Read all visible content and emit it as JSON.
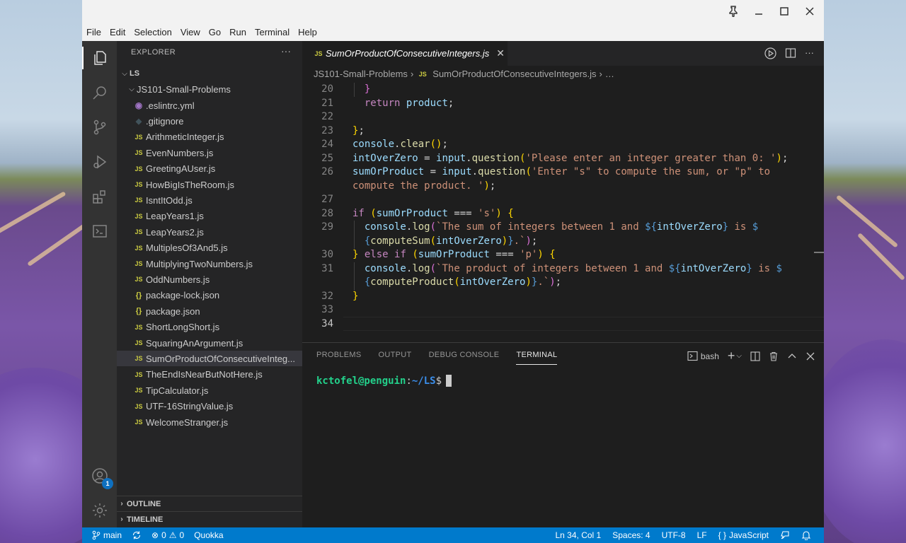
{
  "menu": [
    "File",
    "Edit",
    "Selection",
    "View",
    "Go",
    "Run",
    "Terminal",
    "Help"
  ],
  "explorer": {
    "title": "EXPLORER",
    "more": "···",
    "root": "LS",
    "folder": "JS101-Small-Problems",
    "files": [
      {
        "name": ".eslintrc.yml",
        "icon": "yml"
      },
      {
        "name": ".gitignore",
        "icon": "git"
      },
      {
        "name": "ArithmeticInteger.js",
        "icon": "js"
      },
      {
        "name": "EvenNumbers.js",
        "icon": "js"
      },
      {
        "name": "GreetingAUser.js",
        "icon": "js"
      },
      {
        "name": "HowBigIsTheRoom.js",
        "icon": "js"
      },
      {
        "name": "IsntItOdd.js",
        "icon": "js"
      },
      {
        "name": "LeapYears1.js",
        "icon": "js"
      },
      {
        "name": "LeapYears2.js",
        "icon": "js"
      },
      {
        "name": "MultiplesOf3And5.js",
        "icon": "js"
      },
      {
        "name": "MultiplyingTwoNumbers.js",
        "icon": "js"
      },
      {
        "name": "OddNumbers.js",
        "icon": "js"
      },
      {
        "name": "package-lock.json",
        "icon": "json"
      },
      {
        "name": "package.json",
        "icon": "json"
      },
      {
        "name": "ShortLongShort.js",
        "icon": "js"
      },
      {
        "name": "SquaringAnArgument.js",
        "icon": "js"
      },
      {
        "name": "SumOrProductOfConsecutiveInteg...",
        "icon": "js",
        "selected": true
      },
      {
        "name": "TheEndIsNearButNotHere.js",
        "icon": "js"
      },
      {
        "name": "TipCalculator.js",
        "icon": "js"
      },
      {
        "name": "UTF-16StringValue.js",
        "icon": "js"
      },
      {
        "name": "WelcomeStranger.js",
        "icon": "js"
      }
    ],
    "outline": "OUTLINE",
    "timeline": "TIMELINE"
  },
  "file_icon_labels": {
    "js": "JS",
    "json": "{}",
    "yml": "◉",
    "git": "◆"
  },
  "editor": {
    "tab_label": "SumOrProductOfConsecutiveIntegers.js",
    "tab_close": "✕",
    "breadcrumb": [
      "JS101-Small-Problems",
      "SumOrProductOfConsecutiveIntegers.js",
      "…"
    ],
    "lines": [
      {
        "n": "20",
        "html": "  <span class=\"br2\">}</span>"
      },
      {
        "n": "21",
        "html": "  <span class=\"kw\">return</span> <span class=\"id\">product</span>;"
      },
      {
        "n": "22",
        "html": ""
      },
      {
        "n": "23",
        "html": "<span class=\"br\">}</span>;"
      },
      {
        "n": "24",
        "html": "<span class=\"id\">console</span>.<span class=\"fn\">clear</span><span class=\"br\">()</span>;"
      },
      {
        "n": "25",
        "html": "<span class=\"id\">intOverZero</span> = <span class=\"id\">input</span>.<span class=\"fn\">question</span><span class=\"br\">(</span><span class=\"str\">'Please enter an integer greater than 0: '</span><span class=\"br\">)</span>;"
      },
      {
        "n": "26",
        "html": "<span class=\"id\">sumOrProduct</span> = <span class=\"id\">input</span>.<span class=\"fn\">question</span><span class=\"br\">(</span><span class=\"str\">'Enter \"s\" to compute the sum, or \"p\" to</span>"
      },
      {
        "n": "",
        "html": "<span class=\"str\">compute the product. '</span><span class=\"br\">)</span>;"
      },
      {
        "n": "27",
        "html": ""
      },
      {
        "n": "28",
        "html": "<span class=\"kw\">if</span> <span class=\"br\">(</span><span class=\"id\">sumOrProduct</span> === <span class=\"str\">'s'</span><span class=\"br\">)</span> <span class=\"br\">{</span>"
      },
      {
        "n": "29",
        "html": "  <span class=\"id\">console</span>.<span class=\"fn\">log</span><span class=\"br2\">(</span><span class=\"str\">`The sum of integers between 1 and </span><span class=\"tpl\">${</span><span class=\"id\">intOverZero</span><span class=\"tpl\">}</span><span class=\"str\"> is </span><span class=\"tpl\">$</span>"
      },
      {
        "n": "",
        "html": "  <span class=\"tpl\">{</span><span class=\"fn\">computeSum</span><span class=\"br\">(</span><span class=\"id\">intOverZero</span><span class=\"br\">)</span><span class=\"tpl\">}</span><span class=\"str\">.`</span><span class=\"br2\">)</span>;"
      },
      {
        "n": "30",
        "html": "<span class=\"br\">}</span> <span class=\"kw\">else if</span> <span class=\"br\">(</span><span class=\"id\">sumOrProduct</span> === <span class=\"str\">'p'</span><span class=\"br\">)</span> <span class=\"br\">{</span>"
      },
      {
        "n": "31",
        "html": "  <span class=\"id\">console</span>.<span class=\"fn\">log</span><span class=\"br2\">(</span><span class=\"str\">`The product of integers between 1 and </span><span class=\"tpl\">${</span><span class=\"id\">intOverZero</span><span class=\"tpl\">}</span><span class=\"str\"> is </span><span class=\"tpl\">$</span>"
      },
      {
        "n": "",
        "html": "  <span class=\"tpl\">{</span><span class=\"fn\">computeProduct</span><span class=\"br\">(</span><span class=\"id\">intOverZero</span><span class=\"br\">)</span><span class=\"tpl\">}</span><span class=\"str\">.`</span><span class=\"br2\">)</span>;"
      },
      {
        "n": "32",
        "html": "<span class=\"br\">}</span>"
      },
      {
        "n": "33",
        "html": ""
      },
      {
        "n": "34",
        "html": "",
        "current": true
      }
    ]
  },
  "panel": {
    "tabs": [
      "PROBLEMS",
      "OUTPUT",
      "DEBUG CONSOLE",
      "TERMINAL"
    ],
    "active_tab": "TERMINAL",
    "shell": "bash",
    "prompt_user": "kctofel@penguin",
    "prompt_sep": ":",
    "prompt_path": "~/LS",
    "prompt_end": "$"
  },
  "status": {
    "branch": "main",
    "errors": "0",
    "warnings": "0",
    "extension": "Quokka",
    "position": "Ln 34, Col 1",
    "spaces": "Spaces: 4",
    "encoding": "UTF-8",
    "eol": "LF",
    "language": "JavaScript"
  },
  "accounts_badge": "1",
  "colors": {
    "statusbar": "#007acc",
    "accent": "#0e70c0",
    "js_icon": "#cbcb41"
  }
}
